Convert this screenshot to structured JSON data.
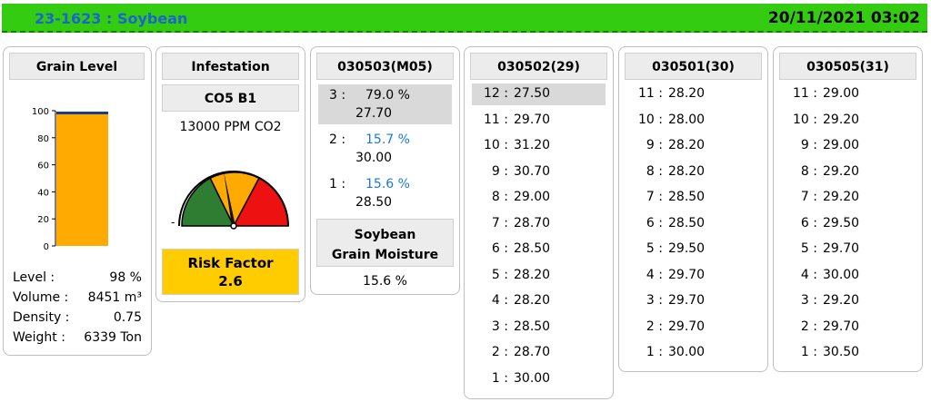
{
  "header": {
    "title": "23-1623 : Soybean",
    "datetime": "20/11/2021 03:02"
  },
  "grain_level": {
    "title": "Grain Level",
    "axis_ticks": [
      "100",
      "80",
      "60",
      "40",
      "20",
      "0"
    ],
    "level_percent": 98,
    "bar_color": "#ffaa00",
    "stats": [
      {
        "label": "Level :",
        "value": "98 %"
      },
      {
        "label": "Volume :",
        "value": "8451 m³"
      },
      {
        "label": "Density :",
        "value": "0.75"
      },
      {
        "label": "Weight :",
        "value": "6339 Ton"
      }
    ]
  },
  "infestation": {
    "title": "Infestation",
    "sensor": "CO5 B1",
    "ppm_text": "13000 PPM CO2",
    "gauge_minus": "-",
    "gauge_colors": [
      "#2e7d32",
      "#ffaa00",
      "#ee1111"
    ],
    "risk_label": "Risk Factor",
    "risk_value": "2.6",
    "risk_color": "#ffcc00"
  },
  "moisture_sensor": {
    "title": "030503(M05)",
    "rows": [
      {
        "num": "3 :",
        "humidity": "79.0 %",
        "temp": "27.70",
        "highlight": true
      },
      {
        "num": "2 :",
        "humidity": "15.7 %",
        "temp": "30.00",
        "highlight": false
      },
      {
        "num": "1 :",
        "humidity": "15.6 %",
        "temp": "28.50",
        "highlight": false
      }
    ],
    "grain_label_line1": "Soybean",
    "grain_label_line2": "Grain Moisture",
    "grain_moisture": "15.6 %"
  },
  "cables": [
    {
      "title": "030502(29)",
      "rows": [
        {
          "num": "12 :",
          "value": "27.50"
        },
        {
          "num": "11 :",
          "value": "29.70"
        },
        {
          "num": "10 :",
          "value": "31.20"
        },
        {
          "num": "9 :",
          "value": "30.70"
        },
        {
          "num": "8 :",
          "value": "29.00"
        },
        {
          "num": "7 :",
          "value": "28.70"
        },
        {
          "num": "6 :",
          "value": "28.50"
        },
        {
          "num": "5 :",
          "value": "28.20"
        },
        {
          "num": "4 :",
          "value": "28.20"
        },
        {
          "num": "3 :",
          "value": "28.50"
        },
        {
          "num": "2 :",
          "value": "28.70"
        },
        {
          "num": "1 :",
          "value": "30.00"
        }
      ]
    },
    {
      "title": "030501(30)",
      "rows": [
        {
          "num": "11 :",
          "value": "28.20"
        },
        {
          "num": "10 :",
          "value": "28.00"
        },
        {
          "num": "9 :",
          "value": "28.20"
        },
        {
          "num": "8 :",
          "value": "28.20"
        },
        {
          "num": "7 :",
          "value": "28.50"
        },
        {
          "num": "6 :",
          "value": "28.50"
        },
        {
          "num": "5 :",
          "value": "29.50"
        },
        {
          "num": "4 :",
          "value": "29.70"
        },
        {
          "num": "3 :",
          "value": "29.70"
        },
        {
          "num": "2 :",
          "value": "29.70"
        },
        {
          "num": "1 :",
          "value": "30.00"
        }
      ]
    },
    {
      "title": "030505(31)",
      "rows": [
        {
          "num": "11 :",
          "value": "29.00"
        },
        {
          "num": "10 :",
          "value": "29.20"
        },
        {
          "num": "9 :",
          "value": "29.00"
        },
        {
          "num": "8 :",
          "value": "29.20"
        },
        {
          "num": "7 :",
          "value": "29.20"
        },
        {
          "num": "6 :",
          "value": "29.50"
        },
        {
          "num": "5 :",
          "value": "29.70"
        },
        {
          "num": "4 :",
          "value": "30.00"
        },
        {
          "num": "3 :",
          "value": "29.20"
        },
        {
          "num": "2 :",
          "value": "29.70"
        },
        {
          "num": "1 :",
          "value": "30.50"
        }
      ]
    }
  ]
}
